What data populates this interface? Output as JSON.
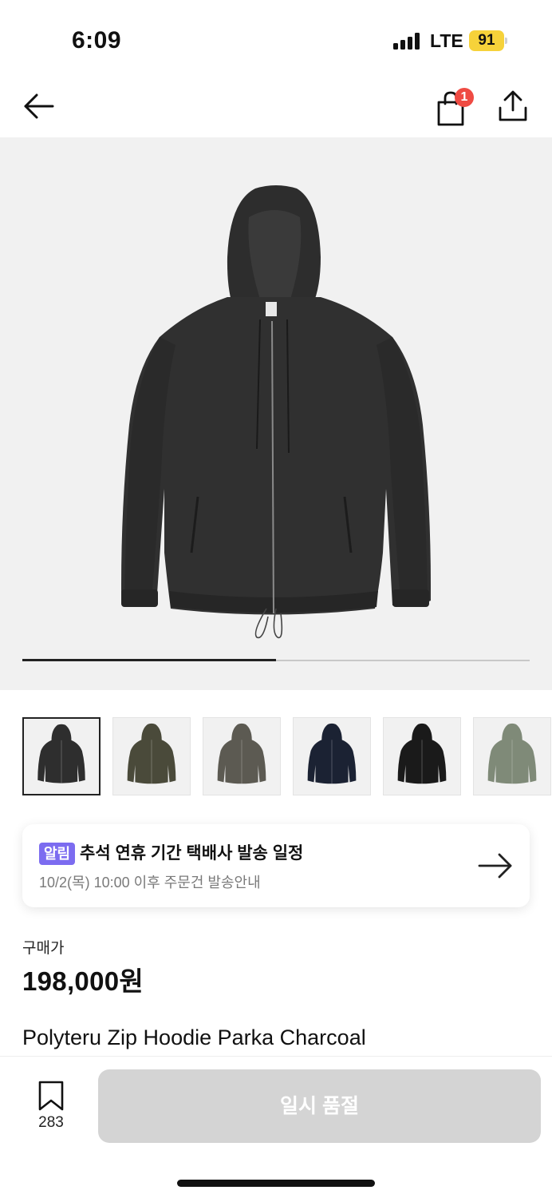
{
  "status_bar": {
    "time": "6:09",
    "network": "LTE",
    "battery": "91",
    "battery_color": "#f6d23a"
  },
  "nav": {
    "back_icon": "arrow-left-icon",
    "bag_icon": "shopping-bag-icon",
    "bag_badge": "1",
    "share_icon": "share-icon",
    "badge_color": "#ef4b43"
  },
  "gallery": {
    "main_image": "charcoal-zip-hoodie-parka",
    "progress": 0.5,
    "thumbnails": [
      {
        "name": "thumb-charcoal",
        "color": "#2e2e2e"
      },
      {
        "name": "thumb-camo",
        "color": "#4a4a3a"
      },
      {
        "name": "thumb-olive-grey",
        "color": "#5c5a52"
      },
      {
        "name": "thumb-navy",
        "color": "#1b2233"
      },
      {
        "name": "thumb-black",
        "color": "#1a1a1a"
      },
      {
        "name": "thumb-sage",
        "color": "#7f8a78"
      }
    ]
  },
  "notice": {
    "badge": "알림",
    "title": "추석 연휴 기간 택배사 발송 일정",
    "subtitle": "10/2(목) 10:00 이후 주문건 발송안내",
    "arrow_icon": "arrow-right-icon",
    "badge_color": "#7c6cf0"
  },
  "product": {
    "price_label": "구매가",
    "price": "198,000원",
    "name": "Polyteru Zip Hoodie Parka Charcoal"
  },
  "bottom_bar": {
    "wish_icon": "bookmark-icon",
    "wish_count": "283",
    "buy_label": "일시 품절"
  }
}
